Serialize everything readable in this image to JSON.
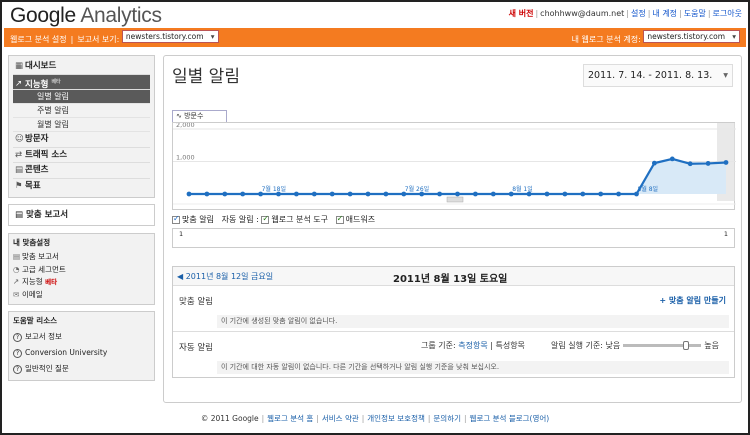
{
  "brand": {
    "google": "Google",
    "product": "Analytics"
  },
  "toplinks": {
    "new_version": "새 버전",
    "email": "chohhww@daum.net",
    "settings": "설정",
    "my_account": "내 계정",
    "help": "도움말",
    "logout": "로그아웃"
  },
  "orange_bar": {
    "settings_link": "웹로그 분석 설정",
    "view_reports_label": "보고서 보기:",
    "view_reports_value": "newsters.tistory.com",
    "my_account_label": "내 웹로그 분석 계정:",
    "my_account_value": "newsters.tistory.com"
  },
  "sidebar": {
    "dashboard": "대시보드",
    "intelligence": "지능형",
    "intelligence_beta": "베타",
    "daily_alerts": "일별 알림",
    "weekly_alerts": "주별 알림",
    "monthly_alerts": "월별 알림",
    "visitors": "방문자",
    "traffic_sources": "트래픽 소스",
    "content": "콘텐츠",
    "goals": "목표",
    "custom_reports": "맞춤 보고서",
    "my_custom_header": "내 맞춤설정",
    "custom_reports_link": "맞춤 보고서",
    "advanced_segments": "고급 세그먼트",
    "intelligence_link": "지능형",
    "intelligence_beta_tag": "베타",
    "email": "이메일",
    "help_header": "도움말 리소스",
    "about_report": "보고서 정보",
    "conversion_university": "Conversion University",
    "faq": "일반적인 질문"
  },
  "main": {
    "title": "일별 알림",
    "date_range": "2011. 7. 14. - 2011. 8. 13.",
    "chart_tab": "방문수",
    "legend": {
      "custom_alerts": "맞춤 알림",
      "auto_alerts_label": "자동 알림 :",
      "analytics_tools": "웹로그 분석 도구",
      "adwords": "애드워즈"
    },
    "strip_left": "1",
    "strip_right": "1",
    "prev_date": "2011년 8월 12일 금요일",
    "current_date": "2011년 8월 13일 토요일",
    "custom_section": {
      "title": "맞춤 알림",
      "create_link": "+ 맞춤 알림 만들기",
      "empty_note": "이 기간에 생성된 맞춤 알림이 없습니다."
    },
    "auto_section": {
      "title": "자동 알림",
      "group_by_label": "그룹 기준:",
      "group_metric": "측정항목",
      "group_dimension": "특성항목",
      "sensitivity_label": "알림 실행 기준:",
      "low": "낮음",
      "high": "높음",
      "empty_note": "이 기간에 대한 자동 알림이 없습니다. 다른 기간을 선택하거나 알림 실행 기준을 낮춰 보십시오."
    }
  },
  "chart_data": {
    "type": "line",
    "series": [
      {
        "name": "방문수",
        "x": [
          "2011-07-14",
          "2011-07-15",
          "2011-07-16",
          "2011-07-17",
          "2011-07-18",
          "2011-07-19",
          "2011-07-20",
          "2011-07-21",
          "2011-07-22",
          "2011-07-23",
          "2011-07-24",
          "2011-07-25",
          "2011-07-26",
          "2011-07-27",
          "2011-07-28",
          "2011-07-29",
          "2011-07-30",
          "2011-07-31",
          "2011-08-01",
          "2011-08-02",
          "2011-08-03",
          "2011-08-04",
          "2011-08-05",
          "2011-08-06",
          "2011-08-07",
          "2011-08-08",
          "2011-08-09",
          "2011-08-10",
          "2011-08-11",
          "2011-08-12",
          "2011-08-13"
        ],
        "values": [
          0,
          0,
          0,
          0,
          0,
          0,
          0,
          0,
          0,
          0,
          0,
          0,
          0,
          0,
          0,
          0,
          0,
          0,
          0,
          0,
          0,
          0,
          0,
          0,
          0,
          0,
          950,
          1080,
          930,
          940,
          970
        ]
      }
    ],
    "ylim": [
      0,
      2000
    ],
    "yticks": [
      "2,000",
      "1,000"
    ],
    "x_labels": [
      "7월 18일",
      "7월 26일",
      "8월 1일",
      "8월 8일"
    ],
    "grid": true,
    "colors": {
      "line": "#1f6fc1",
      "area": "#d8e9f7",
      "highlight": "#e0e0e0"
    }
  },
  "footer": {
    "copyright": "© 2011 Google",
    "home": "웹로그 분석 홈",
    "terms": "서비스 약관",
    "privacy": "개인정보 보호정책",
    "contact": "문의하기",
    "blog": "웹로그 분석 블로그(영어)"
  }
}
